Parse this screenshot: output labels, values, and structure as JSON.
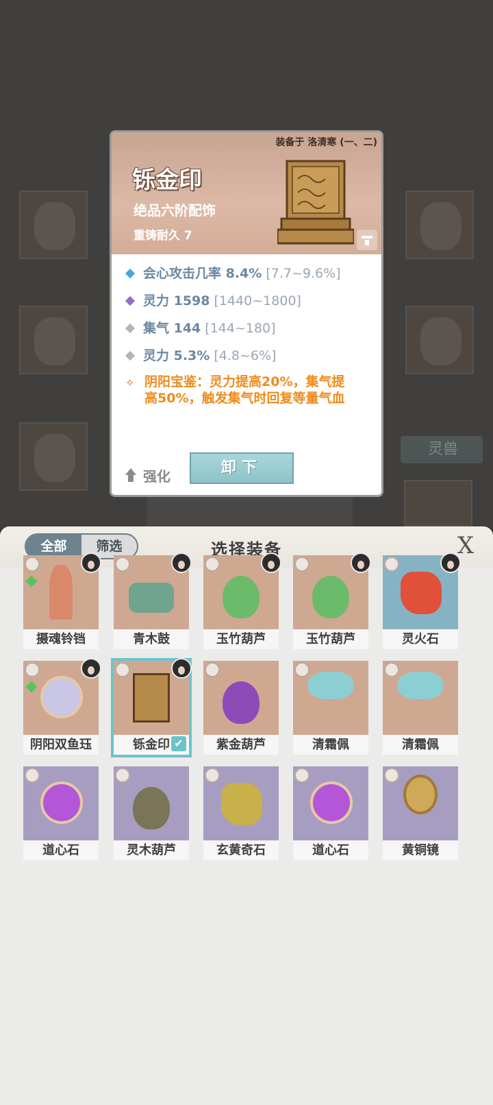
{
  "detail": {
    "equipped_by": "装备于 洛清寒 (一、二)",
    "name": "铄金印",
    "grade": "绝品六阶配饰",
    "durability": "重铸耐久 7",
    "stats": [
      {
        "value": "会心攻击几率 8.4%",
        "range": "[7.7~9.6%]",
        "color": "#4aa6d6"
      },
      {
        "value": "灵力 1598",
        "range": "[1440~1800]",
        "color": "#9a6cc4"
      },
      {
        "value": "集气 144",
        "range": "[144~180]",
        "color": "#b4b4b4"
      },
      {
        "value": "灵力 5.3%",
        "range": "[4.8~6%]",
        "color": "#b4b4b4"
      }
    ],
    "skill_line1": "阴阳宝鉴：灵力提高20%，集气提",
    "skill_line2": "高50%，触发集气时回复等量气血",
    "enhance_label": "强化",
    "unequip_label": "卸下"
  },
  "background": {
    "tag_label": "灵兽"
  },
  "panel": {
    "tab_all": "全部",
    "tab_filter": "筛选",
    "title": "选择装备",
    "close_label": "X",
    "items": [
      {
        "name": "摄魂铃铛",
        "has_avatar": true,
        "mark": "green",
        "bg": "tan",
        "check": ""
      },
      {
        "name": "青木鼓",
        "has_avatar": true,
        "mark": "",
        "bg": "tan",
        "check": ""
      },
      {
        "name": "玉竹葫芦",
        "has_avatar": true,
        "mark": "",
        "bg": "tan",
        "check": ""
      },
      {
        "name": "玉竹葫芦",
        "has_avatar": true,
        "mark": "",
        "bg": "tan",
        "check": ""
      },
      {
        "name": "灵火石",
        "has_avatar": true,
        "mark": "",
        "bg": "blue",
        "check": ""
      },
      {
        "name": "阴阳双鱼珏",
        "has_avatar": true,
        "mark": "green",
        "bg": "tan",
        "check": ""
      },
      {
        "name": "铄金印",
        "has_avatar": true,
        "mark": "",
        "bg": "tan",
        "check": "✔"
      },
      {
        "name": "紫金葫芦",
        "has_avatar": false,
        "mark": "",
        "bg": "tan",
        "check": ""
      },
      {
        "name": "清霜佩",
        "has_avatar": false,
        "mark": "",
        "bg": "tan",
        "check": ""
      },
      {
        "name": "清霜佩",
        "has_avatar": false,
        "mark": "",
        "bg": "tan",
        "check": ""
      },
      {
        "name": "道心石",
        "has_avatar": false,
        "mark": "",
        "bg": "lav",
        "check": ""
      },
      {
        "name": "灵木葫芦",
        "has_avatar": false,
        "mark": "",
        "bg": "lav",
        "check": ""
      },
      {
        "name": "玄黄奇石",
        "has_avatar": false,
        "mark": "",
        "bg": "lav",
        "check": ""
      },
      {
        "name": "道心石",
        "has_avatar": false,
        "mark": "",
        "bg": "lav",
        "check": ""
      },
      {
        "name": "黄铜镜",
        "has_avatar": false,
        "mark": "",
        "bg": "lav",
        "check": ""
      }
    ]
  }
}
